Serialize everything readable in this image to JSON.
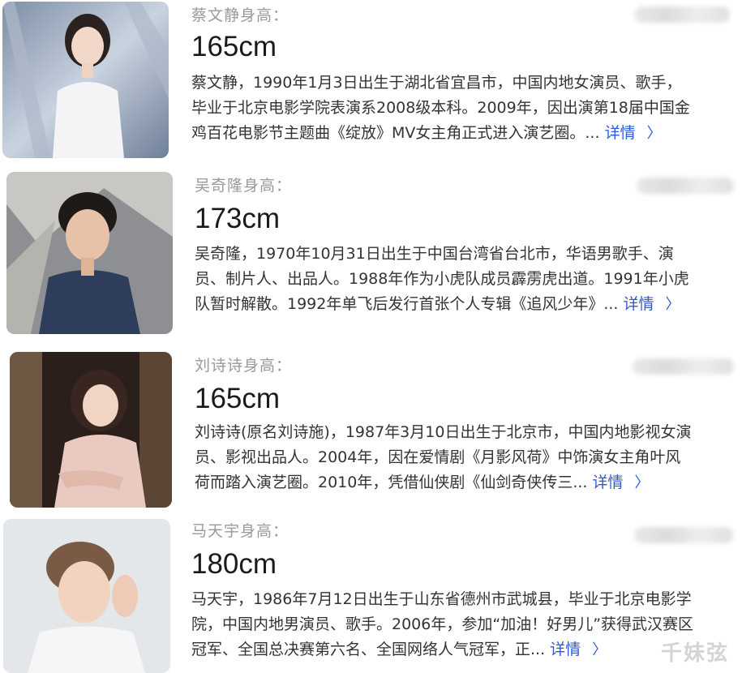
{
  "results": [
    {
      "label": "蔡文静身高：",
      "height": "165cm",
      "lines": [
        "蔡文静，1990年1月3日出生于湖北省宜昌市，中国内地女演员、歌手，",
        "毕业于北京电影学院表演系2008级本科。2009年，因出演第18届中国金",
        "鸡百花电影节主题曲《绽放》MV女主角正式进入演艺圈。..."
      ],
      "more": "详情",
      "chevron": "〉"
    },
    {
      "label": "吴奇隆身高：",
      "height": "173cm",
      "lines": [
        "吴奇隆，1970年10月31日出生于中国台湾省台北市，华语男歌手、演",
        "员、制片人、出品人。1988年作为小虎队成员霹雳虎出道。1991年小虎",
        "队暂时解散。1992年单飞后发行首张个人专辑《追风少年》..."
      ],
      "more": "详情",
      "chevron": "〉"
    },
    {
      "label": "刘诗诗身高：",
      "height": "165cm",
      "lines": [
        "刘诗诗(原名刘诗施)，1987年3月10日出生于北京市，中国内地影视女演",
        "员、影视出品人。2004年，因在爱情剧《月影风荷》中饰演女主角叶风",
        "荷而踏入演艺圈。2010年，凭借仙侠剧《仙剑奇侠传三..."
      ],
      "more": "详情",
      "chevron": "〉"
    },
    {
      "label": "马天宇身高：",
      "height": "180cm",
      "lines": [
        "马天宇，1986年7月12日出生于山东省德州市武城县，毕业于北京电影学",
        "院，中国内地男演员、歌手。2006年，参加“加油！好男儿”获得武汉赛区",
        "冠军、全国总决赛第六名、全国网络人气冠军，正..."
      ],
      "more": "详情",
      "chevron": "〉"
    }
  ],
  "watermark": "千妹弦"
}
